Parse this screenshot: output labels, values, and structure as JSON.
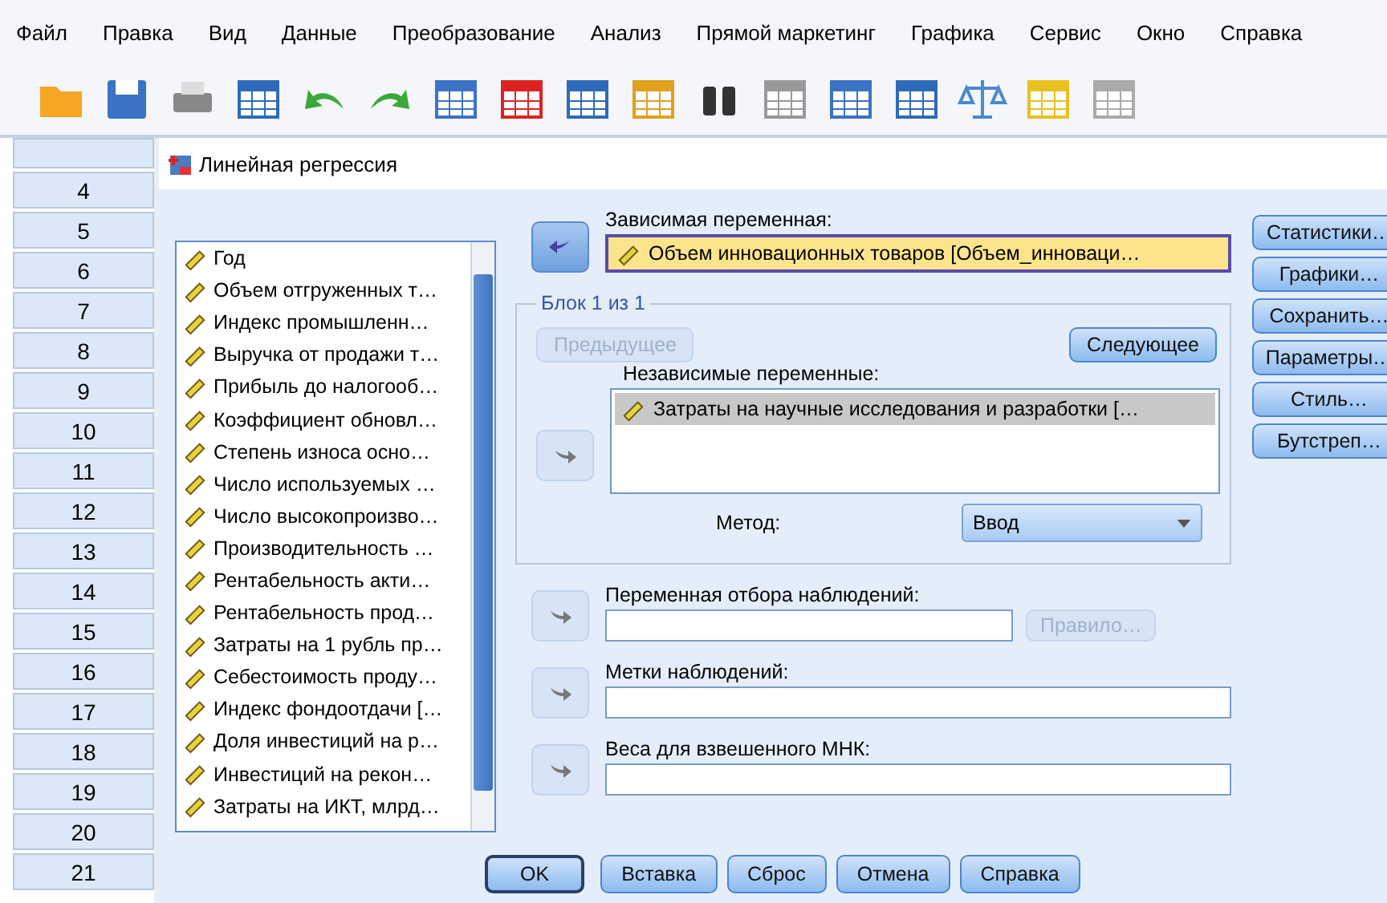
{
  "menu": [
    "Файл",
    "Правка",
    "Вид",
    "Данные",
    "Преобразование",
    "Анализ",
    "Прямой маркетинг",
    "Графика",
    "Сервис",
    "Окно",
    "Справка"
  ],
  "row_headers": [
    "4",
    "5",
    "6",
    "7",
    "8",
    "9",
    "10",
    "11",
    "12",
    "13",
    "14",
    "15",
    "16",
    "17",
    "18",
    "19",
    "20",
    "21"
  ],
  "dialog": {
    "title": "Линейная регрессия",
    "variables": [
      {
        "name": "Год"
      },
      {
        "name": "Объем отгруженных т…"
      },
      {
        "name": "Индекс промышленн…"
      },
      {
        "name": "Выручка от продажи т…"
      },
      {
        "name": "Прибыль до налогооб…"
      },
      {
        "name": "Коэффициент обновл…"
      },
      {
        "name": "Степень износа осно…"
      },
      {
        "name": "Число используемых …"
      },
      {
        "name": "Число высокопроизво…"
      },
      {
        "name": "Производительность …"
      },
      {
        "name": "Рентабельность акти…"
      },
      {
        "name": "Рентабельность прод…"
      },
      {
        "name": "Затраты на 1 рубль пр…"
      },
      {
        "name": "Себестоимость проду…"
      },
      {
        "name": "Индекс фондоотдачи […"
      },
      {
        "name": "Доля инвестиций на р…"
      },
      {
        "name": "Инвестиций на рекон…"
      },
      {
        "name": "Затраты на ИКТ, млрд…"
      }
    ],
    "dependent": {
      "label": "Зависимая переменная:",
      "value": "Объем инновационных товаров [Объем_инноваци…",
      "arrow_disabled": false
    },
    "block": {
      "title": "Блок 1 из 1",
      "previous": {
        "label": "Предыдущее",
        "disabled": true
      },
      "next": {
        "label": "Следующее",
        "disabled": false
      },
      "independent_label": "Независимые переменные:",
      "arrow_disabled": true,
      "independents": [
        {
          "name": "Затраты на научные исследования и разработки […",
          "selected": true
        }
      ],
      "method_label": "Метод:",
      "method": "Ввод"
    },
    "selection": {
      "label": "Переменная отбора наблюдений:",
      "arrow_disabled": true,
      "rule": {
        "label": "Правило…",
        "disabled": true
      }
    },
    "case_labels": {
      "label": "Метки наблюдений:",
      "arrow_disabled": true
    },
    "wls": {
      "label": "Веса для взвешенного МНК:",
      "arrow_disabled": true
    },
    "side_buttons": [
      "Статистики…",
      "Графики…",
      "Сохранить…",
      "Параметры…",
      "Стиль…",
      "Бутстреп…"
    ],
    "footer_buttons": [
      {
        "label": "OK",
        "default": true
      },
      {
        "label": "Вставка",
        "default": false
      },
      {
        "label": "Сброс",
        "default": false
      },
      {
        "label": "Отмена",
        "default": false
      },
      {
        "label": "Справка",
        "default": false
      }
    ]
  }
}
